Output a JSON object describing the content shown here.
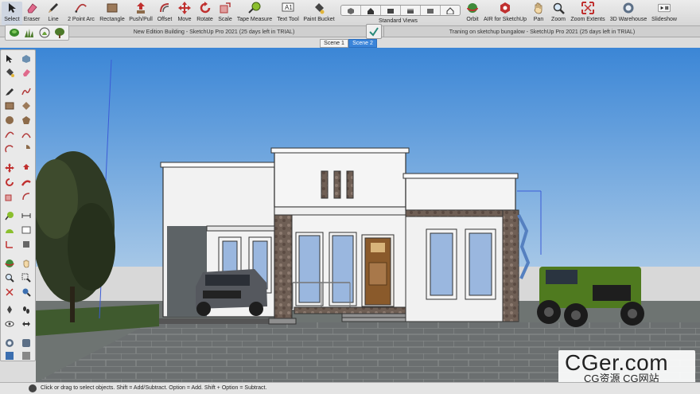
{
  "toolbar": {
    "tools": [
      {
        "id": "select",
        "label": "Select",
        "icon": "select-arrow-icon"
      },
      {
        "id": "eraser",
        "label": "Eraser",
        "icon": "eraser-icon"
      },
      {
        "id": "line",
        "label": "Line",
        "icon": "pencil-icon"
      },
      {
        "id": "arc",
        "label": "2 Point Arc",
        "icon": "arc-icon"
      },
      {
        "id": "rectangle",
        "label": "Rectangle",
        "icon": "rectangle-icon"
      },
      {
        "id": "pushpull",
        "label": "Push/Pull",
        "icon": "push-pull-icon"
      },
      {
        "id": "offset",
        "label": "Offset",
        "icon": "offset-icon"
      },
      {
        "id": "move",
        "label": "Move",
        "icon": "move-icon"
      },
      {
        "id": "rotate",
        "label": "Rotate",
        "icon": "rotate-icon"
      },
      {
        "id": "scale",
        "label": "Scale",
        "icon": "scale-icon"
      },
      {
        "id": "tape",
        "label": "Tape Measure",
        "icon": "tape-measure-icon"
      },
      {
        "id": "text",
        "label": "Text Tool",
        "icon": "text-icon"
      },
      {
        "id": "paint",
        "label": "Paint Bucket",
        "icon": "paint-bucket-icon"
      },
      {
        "id": "orbit",
        "label": "Orbit",
        "icon": "orbit-icon"
      },
      {
        "id": "air",
        "label": "AIR for SketchUp",
        "icon": "air-icon"
      },
      {
        "id": "pan",
        "label": "Pan",
        "icon": "pan-hand-icon"
      },
      {
        "id": "zoom",
        "label": "Zoom",
        "icon": "zoom-icon"
      },
      {
        "id": "zoomext",
        "label": "Zoom Extents",
        "icon": "zoom-extents-icon"
      },
      {
        "id": "warehouse",
        "label": "3D Warehouse",
        "icon": "warehouse-icon"
      },
      {
        "id": "slideshow",
        "label": "Slideshow",
        "icon": "slideshow-icon"
      }
    ],
    "standard_views_label": "Standard Views"
  },
  "windows": {
    "tab1": "New Edition Building  - SketchUp Pro 2021 (25 days left in TRIAL)",
    "tab2": "Traning on sketchup bungalow - SketchUp Pro 2021 (25 days left in TRIAL)"
  },
  "scenes": [
    "Scene 1",
    "Scene 2"
  ],
  "active_scene": "Scene 2",
  "watermark": {
    "main": "CGer.com",
    "sub": "CG资源 CG网站"
  },
  "status": {
    "text": "Click or drag to select objects. Shift = Add/Subtract. Option = Add. Shift + Option = Subtract."
  },
  "colors": {
    "sky_top": "#3b86d6",
    "sky_bottom": "#b9d3ea",
    "accent": "#3a84d9",
    "car_green": "#4f7a1f",
    "truck_gray": "#55585e",
    "door_wood": "#8a5a2b"
  }
}
